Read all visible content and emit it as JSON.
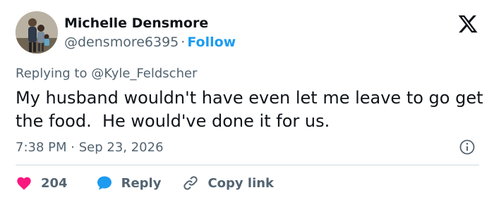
{
  "author": {
    "name": "Michelle Densmore",
    "handle": "@densmore6395",
    "separator": "·",
    "follow_label": "Follow"
  },
  "reply_context": {
    "prefix": "Replying to ",
    "mention": "@Kyle_Feldscher"
  },
  "tweet": {
    "text": "My husband wouldn't have even let me leave to go get the food.  He would've done it for us.",
    "time": "7:38 PM",
    "separator": "·",
    "date": "Sep 23, 2026"
  },
  "actions": {
    "likes_count": "204",
    "reply_label": "Reply",
    "copy_link_label": "Copy link"
  },
  "icons": {
    "brand": "x-logo-icon",
    "info": "info-icon",
    "like": "heart-icon",
    "reply": "speech-bubble-icon",
    "copy": "link-icon"
  },
  "colors": {
    "accent": "#1d9bf0",
    "like": "#f91880",
    "secondary_text": "#536471",
    "primary_text": "#0f1419"
  }
}
